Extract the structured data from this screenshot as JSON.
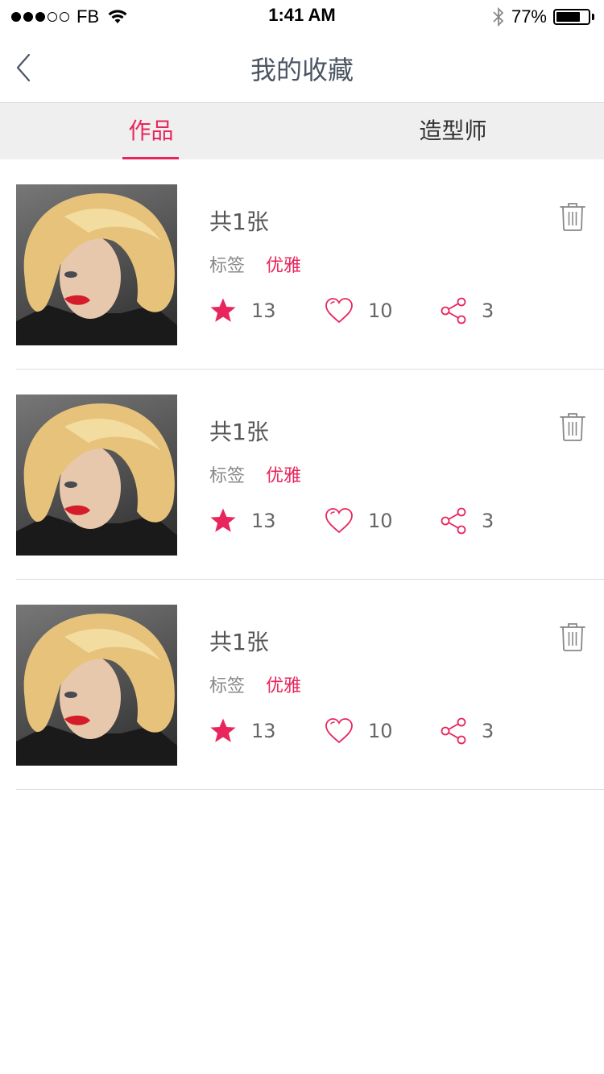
{
  "status_bar": {
    "carrier": "FB",
    "time": "1:41 AM",
    "battery_percent": "77%",
    "battery_level": 0.77,
    "signal_filled": 3,
    "signal_total": 5
  },
  "nav": {
    "title": "我的收藏",
    "back_icon": "chevron-left-icon"
  },
  "tabs": [
    {
      "label": "作品",
      "active": true
    },
    {
      "label": "造型师",
      "active": false
    }
  ],
  "colors": {
    "accent": "#e8265d",
    "title": "#4b5564",
    "tab_bg": "#efefef"
  },
  "items": [
    {
      "title": "共1张",
      "tag_label": "标签",
      "tag_value": "优雅",
      "stars": "13",
      "likes": "10",
      "shares": "3"
    },
    {
      "title": "共1张",
      "tag_label": "标签",
      "tag_value": "优雅",
      "stars": "13",
      "likes": "10",
      "shares": "3"
    },
    {
      "title": "共1张",
      "tag_label": "标签",
      "tag_value": "优雅",
      "stars": "13",
      "likes": "10",
      "shares": "3"
    }
  ]
}
